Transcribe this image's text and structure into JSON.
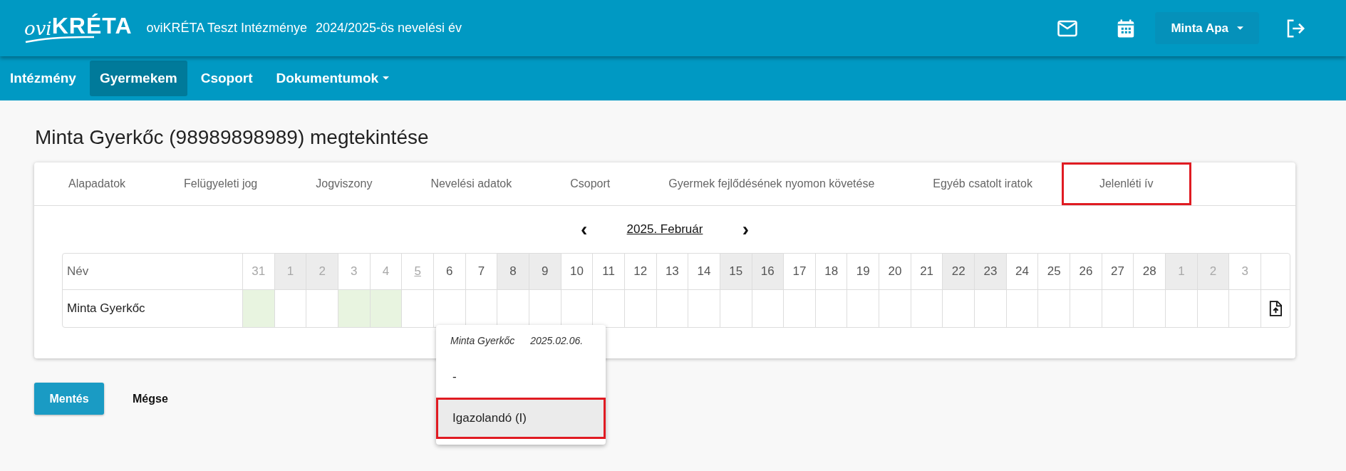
{
  "header": {
    "logo": {
      "script": "ovi",
      "brand": "KRÉTA"
    },
    "institution": "oviKRÉTA Teszt Intézménye",
    "school_year": "2024/2025-ös nevelési év",
    "user_menu": "Minta Apa"
  },
  "nav": [
    {
      "label": "Intézmény",
      "selected": false,
      "dropdown": false
    },
    {
      "label": "Gyermekem",
      "selected": true,
      "dropdown": false
    },
    {
      "label": "Csoport",
      "selected": false,
      "dropdown": false
    },
    {
      "label": "Dokumentumok",
      "selected": false,
      "dropdown": true
    }
  ],
  "page_title": "Minta Gyerkőc (98989898989) megtekintése",
  "tabs": [
    {
      "label": "Alapadatok",
      "highlighted": false
    },
    {
      "label": "Felügyeleti jog",
      "highlighted": false
    },
    {
      "label": "Jogviszony",
      "highlighted": false
    },
    {
      "label": "Nevelési adatok",
      "highlighted": false
    },
    {
      "label": "Csoport",
      "highlighted": false
    },
    {
      "label": "Gyermek fejlődésének nyomon követése",
      "highlighted": false
    },
    {
      "label": "Egyéb csatolt iratok",
      "highlighted": false
    },
    {
      "label": "Jelenléti ív",
      "highlighted": true
    }
  ],
  "month_nav": {
    "prev": "‹",
    "month": "2025. Február",
    "next": "›"
  },
  "attendance": {
    "name_header": "Név",
    "child_name": "Minta Gyerkőc",
    "days": [
      {
        "label": "31",
        "disabled": true,
        "weekend": false,
        "today": false,
        "marked": true
      },
      {
        "label": "1",
        "disabled": true,
        "weekend": true,
        "today": false,
        "marked": false
      },
      {
        "label": "2",
        "disabled": true,
        "weekend": true,
        "today": false,
        "marked": false
      },
      {
        "label": "3",
        "disabled": true,
        "weekend": false,
        "today": false,
        "marked": true
      },
      {
        "label": "4",
        "disabled": true,
        "weekend": false,
        "today": false,
        "marked": true
      },
      {
        "label": "5",
        "disabled": true,
        "weekend": false,
        "today": true,
        "marked": false
      },
      {
        "label": "6",
        "disabled": false,
        "weekend": false,
        "today": false,
        "marked": false
      },
      {
        "label": "7",
        "disabled": false,
        "weekend": false,
        "today": false,
        "marked": false
      },
      {
        "label": "8",
        "disabled": false,
        "weekend": true,
        "today": false,
        "marked": false
      },
      {
        "label": "9",
        "disabled": false,
        "weekend": true,
        "today": false,
        "marked": false
      },
      {
        "label": "10",
        "disabled": false,
        "weekend": false,
        "today": false,
        "marked": false
      },
      {
        "label": "11",
        "disabled": false,
        "weekend": false,
        "today": false,
        "marked": false
      },
      {
        "label": "12",
        "disabled": false,
        "weekend": false,
        "today": false,
        "marked": false
      },
      {
        "label": "13",
        "disabled": false,
        "weekend": false,
        "today": false,
        "marked": false
      },
      {
        "label": "14",
        "disabled": false,
        "weekend": false,
        "today": false,
        "marked": false
      },
      {
        "label": "15",
        "disabled": false,
        "weekend": true,
        "today": false,
        "marked": false
      },
      {
        "label": "16",
        "disabled": false,
        "weekend": true,
        "today": false,
        "marked": false
      },
      {
        "label": "17",
        "disabled": false,
        "weekend": false,
        "today": false,
        "marked": false
      },
      {
        "label": "18",
        "disabled": false,
        "weekend": false,
        "today": false,
        "marked": false
      },
      {
        "label": "19",
        "disabled": false,
        "weekend": false,
        "today": false,
        "marked": false
      },
      {
        "label": "20",
        "disabled": false,
        "weekend": false,
        "today": false,
        "marked": false
      },
      {
        "label": "21",
        "disabled": false,
        "weekend": false,
        "today": false,
        "marked": false
      },
      {
        "label": "22",
        "disabled": false,
        "weekend": true,
        "today": false,
        "marked": false
      },
      {
        "label": "23",
        "disabled": false,
        "weekend": true,
        "today": false,
        "marked": false
      },
      {
        "label": "24",
        "disabled": false,
        "weekend": false,
        "today": false,
        "marked": false
      },
      {
        "label": "25",
        "disabled": false,
        "weekend": false,
        "today": false,
        "marked": false
      },
      {
        "label": "26",
        "disabled": false,
        "weekend": false,
        "today": false,
        "marked": false
      },
      {
        "label": "27",
        "disabled": false,
        "weekend": false,
        "today": false,
        "marked": false
      },
      {
        "label": "28",
        "disabled": false,
        "weekend": false,
        "today": false,
        "marked": false
      },
      {
        "label": "1",
        "disabled": true,
        "weekend": true,
        "today": false,
        "marked": false
      },
      {
        "label": "2",
        "disabled": true,
        "weekend": true,
        "today": false,
        "marked": false
      },
      {
        "label": "3",
        "disabled": true,
        "weekend": false,
        "today": false,
        "marked": false
      }
    ]
  },
  "popup": {
    "name": "Minta Gyerkőc",
    "date": "2025.02.06.",
    "options": [
      {
        "label": "-",
        "selected": false,
        "highlighted": false
      },
      {
        "label": "Igazolandó (I)",
        "selected": true,
        "highlighted": true
      }
    ]
  },
  "buttons": [
    {
      "label": "Mentés",
      "kind": "primary"
    },
    {
      "label": "Mégse",
      "kind": "plain"
    }
  ]
}
